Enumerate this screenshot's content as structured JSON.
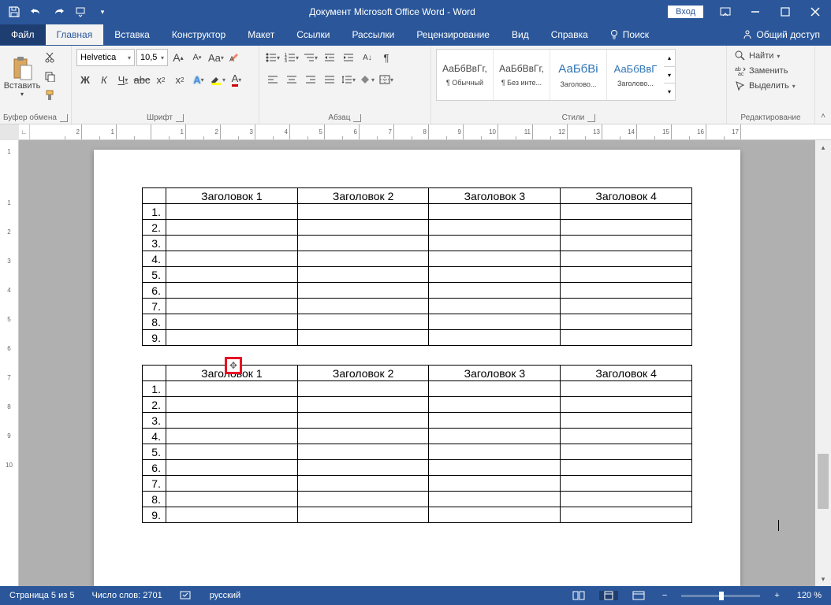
{
  "titlebar": {
    "document_title": "Документ Microsoft Office Word  -  Word",
    "login": "Вход"
  },
  "tabs": {
    "file": "Файл",
    "home": "Главная",
    "insert": "Вставка",
    "design": "Конструктор",
    "layout": "Макет",
    "references": "Ссылки",
    "mailings": "Рассылки",
    "review": "Рецензирование",
    "view": "Вид",
    "help": "Справка",
    "search": "Поиск",
    "share": "Общий доступ"
  },
  "ribbon": {
    "clipboard": {
      "label": "Буфер обмена",
      "paste": "Вставить"
    },
    "font": {
      "label": "Шрифт",
      "name": "Helvetica",
      "size": "10,5"
    },
    "paragraph": {
      "label": "Абзац"
    },
    "styles": {
      "label": "Стили",
      "items": [
        {
          "preview": "АаБбВвГг,",
          "name": "¶ Обычный"
        },
        {
          "preview": "АаБбВвГг,",
          "name": "¶ Без инте..."
        },
        {
          "preview": "АаБбВі",
          "name": "Заголово..."
        },
        {
          "preview": "АаБбВвГ",
          "name": "Заголово..."
        }
      ]
    },
    "editing": {
      "label": "Редактирование",
      "find": "Найти",
      "replace": "Заменить",
      "select": "Выделить"
    }
  },
  "tables": {
    "headers": [
      "Заголовок 1",
      "Заголовок 2",
      "Заголовок 3",
      "Заголовок 4"
    ],
    "rows": [
      "1.",
      "2.",
      "3.",
      "4.",
      "5.",
      "6.",
      "7.",
      "8.",
      "9."
    ]
  },
  "statusbar": {
    "page": "Страница 5 из 5",
    "words": "Число слов: 2701",
    "language": "русский",
    "zoom": "120 %"
  },
  "ruler": {
    "h": [
      "2",
      "1",
      "",
      "1",
      "2",
      "3",
      "4",
      "5",
      "6",
      "7",
      "8",
      "9",
      "10",
      "11",
      "12",
      "13",
      "14",
      "15",
      "16",
      "17"
    ],
    "v": [
      "1",
      "",
      "1",
      "2",
      "3",
      "4",
      "5",
      "6",
      "7",
      "8",
      "9",
      "10"
    ]
  }
}
